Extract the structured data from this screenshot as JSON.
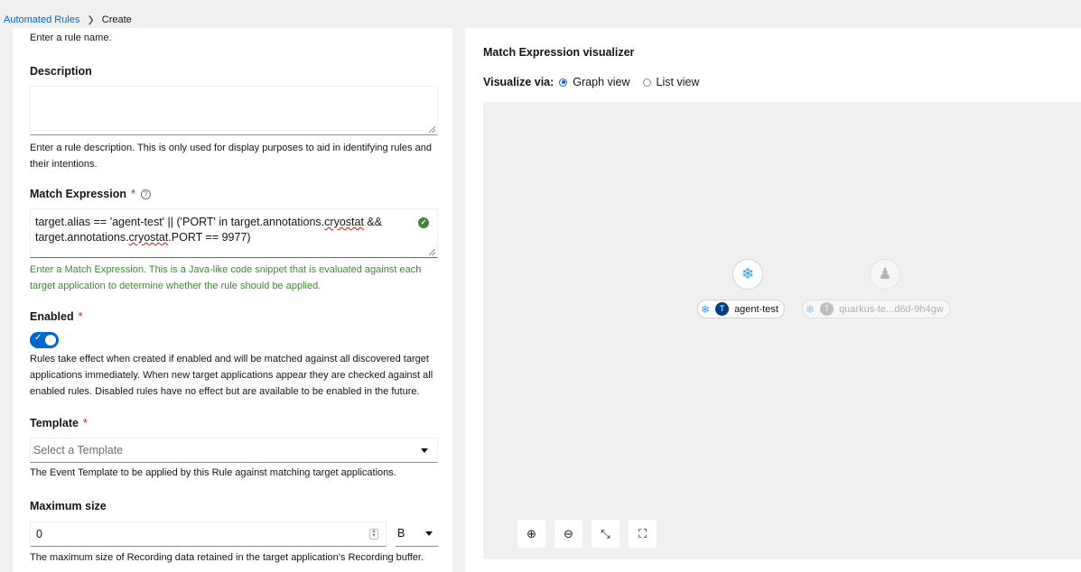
{
  "breadcrumb": {
    "parent": "Automated Rules",
    "current": "Create"
  },
  "form": {
    "name_hint": "Enter a rule name.",
    "description": {
      "label": "Description",
      "value": "",
      "hint_1": "Enter a rule description. This is only used for display purposes to aid in identifying rules and",
      "hint_2": "their intentions."
    },
    "match_expression": {
      "label": "Match Expression",
      "required": "*",
      "help": "?",
      "line1_a": "target.alias == 'agent-test' || ('PORT' in target.annotations.",
      "line1_b": "cryostat",
      "line1_c": " &&",
      "line2_a": "target.annotations.",
      "line2_b": "cryostat",
      "line2_c": ".PORT == 9977)",
      "hint_1": "Enter a Match Expression. This is a Java-like code snippet that is evaluated against each",
      "hint_2": "target application to determine whether the rule should be applied."
    },
    "enabled": {
      "label": "Enabled",
      "required": "*",
      "value": true,
      "hint_1": "Rules take effect when created if enabled and will be matched against all discovered target",
      "hint_2": "applications immediately. When new target applications appear they are checked against all",
      "hint_3": "enabled rules. Disabled rules have no effect but are available to be enabled in the future."
    },
    "template": {
      "label": "Template",
      "required": "*",
      "placeholder": "Select a Template",
      "hint": "The Event Template to be applied by this Rule against matching target applications."
    },
    "max_size": {
      "label": "Maximum size",
      "value": "0",
      "unit": "B",
      "hint": "The maximum size of Recording data retained in the target application's Recording buffer."
    }
  },
  "visualizer": {
    "title": "Match Expression visualizer",
    "visualize_via": "Visualize via:",
    "options": [
      "Graph view",
      "List view"
    ],
    "selected": "Graph view",
    "nodes": [
      {
        "label": "agent-test",
        "badge": "T",
        "icon": "cryostat-icon",
        "matched": true
      },
      {
        "label": "quarkus-te...d6d-9h4gw",
        "badge": "T",
        "icon": "quarkus-icon",
        "matched": false
      }
    ],
    "toolbar": [
      "zoom-in-icon",
      "zoom-out-icon",
      "fit-to-screen-icon",
      "reset-view-icon"
    ]
  },
  "colors": {
    "accent": "#06c",
    "success": "#3e8635",
    "required": "#c9190b"
  }
}
